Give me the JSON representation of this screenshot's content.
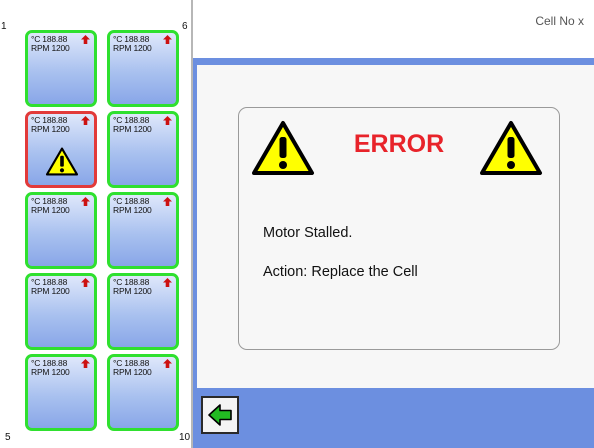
{
  "header": {
    "label": "Cell No  x"
  },
  "corner_numbers": {
    "top_left": "1",
    "top_right": "6",
    "bottom_left": "5",
    "bottom_right": "10"
  },
  "cells": [
    {
      "id": "1",
      "temp": "°C 188.88",
      "rpm": "RPM 1200",
      "status": "ok"
    },
    {
      "id": "6",
      "temp": "°C 188.88",
      "rpm": "RPM 1200",
      "status": "ok"
    },
    {
      "id": "2",
      "temp": "°C 188.88",
      "rpm": "RPM 1200",
      "status": "error"
    },
    {
      "id": "7",
      "temp": "°C 188.88",
      "rpm": "RPM 1200",
      "status": "ok"
    },
    {
      "id": "3",
      "temp": "°C 188.88",
      "rpm": "RPM 1200",
      "status": "ok"
    },
    {
      "id": "8",
      "temp": "°C 188.88",
      "rpm": "RPM 1200",
      "status": "ok"
    },
    {
      "id": "4",
      "temp": "°C 188.88",
      "rpm": "RPM 1200",
      "status": "ok"
    },
    {
      "id": "9",
      "temp": "°C 188.88",
      "rpm": "RPM 1200",
      "status": "ok"
    },
    {
      "id": "5",
      "temp": "°C 188.88",
      "rpm": "RPM 1200",
      "status": "ok"
    },
    {
      "id": "10",
      "temp": "°C 188.88",
      "rpm": "RPM 1200",
      "status": "ok"
    }
  ],
  "error_panel": {
    "title": "ERROR",
    "message": "Motor Stalled.",
    "action": "Action: Replace the Cell",
    "icon": "warning-icon"
  },
  "back_button": {
    "icon": "arrow-left-icon"
  },
  "colors": {
    "ok_border": "#2fe02f",
    "error_border": "#e23a3a",
    "error_title": "#e8232a",
    "background": "#6c8fe0",
    "arrow_up": "#cc1111",
    "back_arrow": "#22bb22"
  }
}
